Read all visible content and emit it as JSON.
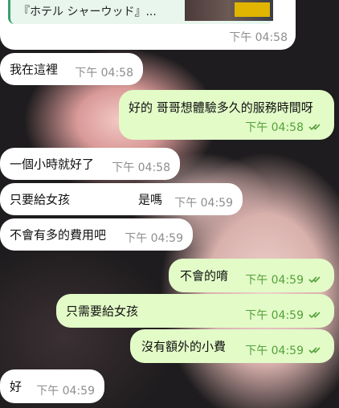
{
  "quoted": {
    "title": "『ホテル シャーウッド』...",
    "time": "下午 04:58"
  },
  "messages": [
    {
      "id": "m1",
      "dir": "in",
      "text": "我在這裡",
      "time": "下午 04:58"
    },
    {
      "id": "m2",
      "dir": "out",
      "text": "好的 哥哥想體驗多久的服務時間呀",
      "time": "下午 04:58",
      "read": true
    },
    {
      "id": "m3",
      "dir": "in",
      "text": "一個小時就好了",
      "time": "下午 04:58"
    },
    {
      "id": "m4",
      "dir": "in",
      "text": "只要給女孩",
      "text_tail": "是嗎",
      "time": "下午 04:59"
    },
    {
      "id": "m5",
      "dir": "in",
      "text": "不會有多的費用吧",
      "time": "下午 04:59"
    },
    {
      "id": "m6",
      "dir": "out",
      "text": "不會的唷",
      "time": "下午 04:59",
      "read": true
    },
    {
      "id": "m7",
      "dir": "out",
      "text": "只需要給女孩",
      "time": "下午 04:59",
      "read": true
    },
    {
      "id": "m8",
      "dir": "out",
      "text": "沒有額外的小費",
      "time": "下午 04:59",
      "read": true
    },
    {
      "id": "m9",
      "dir": "in",
      "text": "好",
      "time": "下午 04:59"
    }
  ],
  "colors": {
    "incoming": "#ffffff",
    "outgoing": "#e2fbc7",
    "read_check": "#55a13b"
  },
  "icons": {
    "read_receipt": "double-check-icon"
  }
}
